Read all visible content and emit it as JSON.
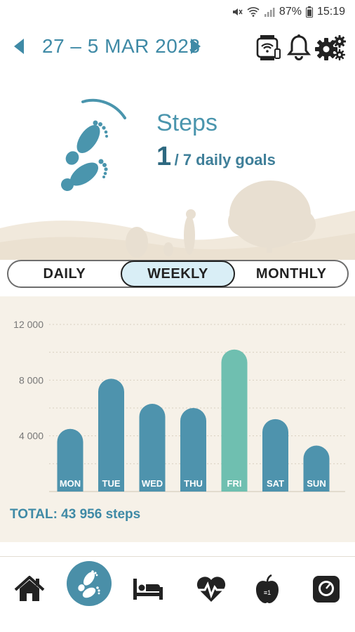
{
  "status_bar": {
    "battery": "87%",
    "time": "15:19"
  },
  "header": {
    "date_range": "27 – 5 MAR 2023"
  },
  "icons": {
    "prev": "chevron-left-icon",
    "next": "chevron-right-icon",
    "watch": "watch-icon",
    "bell": "bell-icon",
    "settings": "gears-icon"
  },
  "summary": {
    "title": "Steps",
    "goals_met": "1",
    "goals_text": "/ 7 daily goals"
  },
  "tabs": [
    {
      "label": "DAILY",
      "active": false
    },
    {
      "label": "WEEKLY",
      "active": true
    },
    {
      "label": "MONTHLY",
      "active": false
    }
  ],
  "chart_data": {
    "type": "bar",
    "categories": [
      "MON",
      "TUE",
      "WED",
      "THU",
      "FRI",
      "SAT",
      "SUN"
    ],
    "values": [
      4500,
      8100,
      6300,
      6000,
      10200,
      5200,
      3300
    ],
    "highlight_index": 4,
    "ytick_labels": [
      "12 000",
      "8 000",
      "4 000"
    ],
    "yticks": [
      12000,
      8000,
      4000
    ],
    "ylim": [
      0,
      12000
    ],
    "grid": true,
    "colors": {
      "bar": "#4e93ad",
      "highlight": "#6fbfb0",
      "label": "#ffffff"
    }
  },
  "total": {
    "text": "TOTAL: 43 956 steps"
  },
  "bottom_nav": [
    {
      "icon": "home-icon",
      "active": false
    },
    {
      "icon": "footprints-icon",
      "active": true
    },
    {
      "icon": "bed-icon",
      "active": false
    },
    {
      "icon": "heart-rate-icon",
      "active": false
    },
    {
      "icon": "apple-icon",
      "active": false
    },
    {
      "icon": "scale-icon",
      "active": false
    }
  ]
}
